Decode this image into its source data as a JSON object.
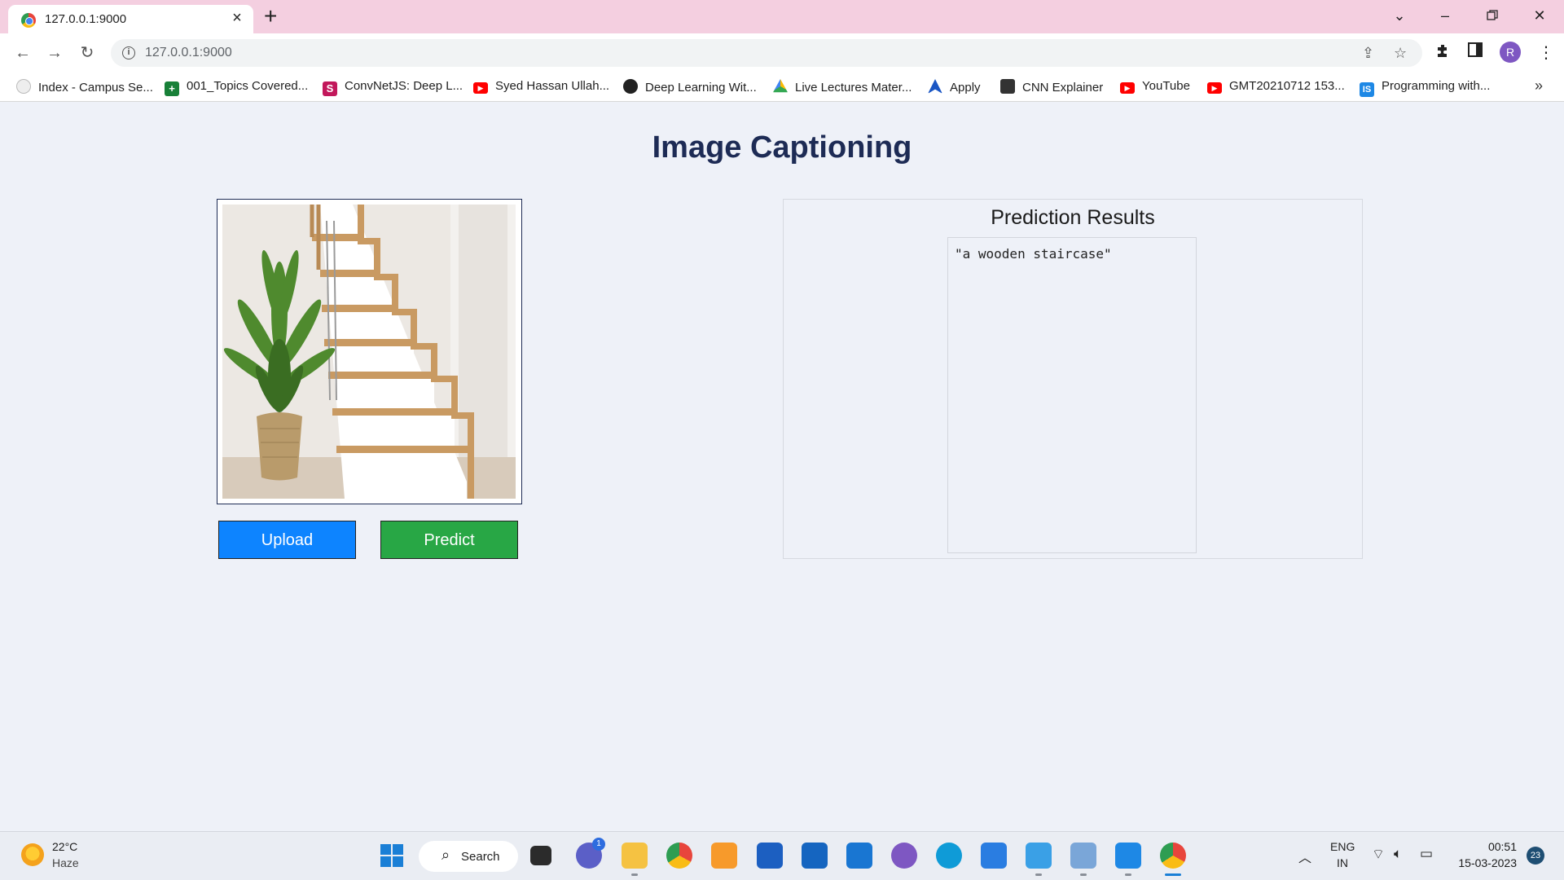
{
  "browser": {
    "tab_title": "127.0.0.1:9000",
    "url": "127.0.0.1:9000",
    "profile_initial": "R",
    "bookmarks": [
      {
        "label": "Index - Campus Se..."
      },
      {
        "label": "001_Topics Covered..."
      },
      {
        "label": "ConvNetJS: Deep L..."
      },
      {
        "label": "Syed Hassan Ullah..."
      },
      {
        "label": "Deep Learning Wit..."
      },
      {
        "label": "Live Lectures Mater..."
      },
      {
        "label": "Apply"
      },
      {
        "label": "CNN Explainer"
      },
      {
        "label": "YouTube"
      },
      {
        "label": "GMT20210712 153..."
      },
      {
        "label": "Programming with..."
      }
    ]
  },
  "page": {
    "title": "Image Captioning",
    "upload_label": "Upload",
    "predict_label": "Predict",
    "results_title": "Prediction Results",
    "prediction": "\"a wooden staircase\""
  },
  "taskbar": {
    "weather_temp": "22°C",
    "weather_desc": "Haze",
    "search_label": "Search",
    "lang_top": "ENG",
    "lang_bottom": "IN",
    "time": "00:51",
    "date": "15-03-2023",
    "notification_count": "23",
    "chat_badge": "1"
  },
  "colors": {
    "title": "#1d2b55",
    "upload": "#0d84ff",
    "predict": "#28a745",
    "page_bg": "#eef1f8",
    "tabstrip": "#f4cfe0"
  }
}
